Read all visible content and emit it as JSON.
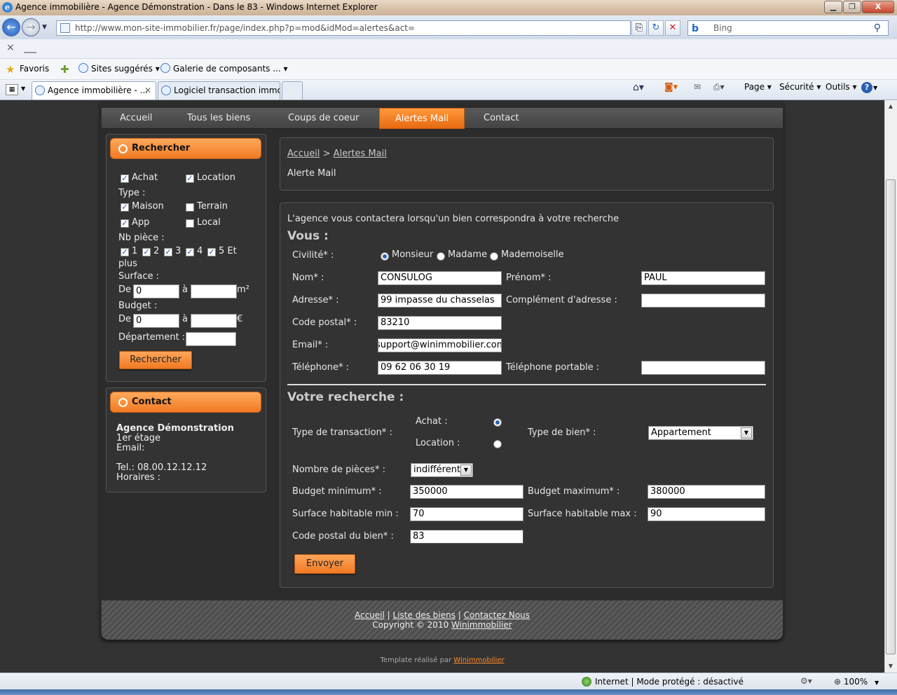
{
  "window": {
    "title": "Agence immobilière - Agence Démonstration - Dans le 83 - Windows Internet Explorer",
    "minimize": "▁",
    "maximize": "❐",
    "close": "X"
  },
  "browser": {
    "url": "http://www.mon-site-immobilier.fr/page/index.php?p=mod&idMod=alertes&act=",
    "search_placeholder": "Bing",
    "favorites_label": "Favoris",
    "favorites_items": [
      "Sites suggérés ▾",
      "Galerie de composants ... ▾"
    ],
    "tabs": [
      "Agence immobilière - ...",
      "Logiciel transaction immo..."
    ],
    "commands": [
      "Page ▾",
      "Sécurité ▾",
      "Outils ▾"
    ],
    "status_text": "Internet | Mode protégé : désactivé",
    "zoom": "100%"
  },
  "menu": [
    "Accueil",
    "Tous les biens",
    "Coups de coeur",
    "Alertes Mail",
    "Contact"
  ],
  "search_panel": {
    "title": "Rechercher",
    "achat": "Achat",
    "location": "Location",
    "type_label": "Type :",
    "maison": "Maison",
    "terrain": "Terrain",
    "app": "App",
    "local": "Local",
    "nb_piece_label": "Nb pièce :",
    "pieces": [
      "1",
      "2",
      "3",
      "4",
      "5 Et"
    ],
    "plus": "plus",
    "surface_label": "Surface :",
    "de": "De",
    "a": "à",
    "surface_from": "0",
    "m2": "m²",
    "budget_label": "Budget :",
    "budget_from": "0",
    "euro": "€",
    "departement_label": "Département :",
    "button": "Rechercher"
  },
  "contact_panel": {
    "title": "Contact",
    "agency": "Agence Démonstration",
    "address": "1er étage",
    "email": "Email:",
    "tel": "Tel.: 08.00.12.12.12",
    "horaires": "Horaires :"
  },
  "breadcrumb": {
    "home": "Accueil",
    "sep": ">",
    "current": "Alertes Mail",
    "page_title": "Alerte Mail"
  },
  "form": {
    "intro": "L'agence vous contactera lorsqu'un bien correspondra à votre recherche",
    "vous_title": "Vous :",
    "civilite_label": "Civilité* :",
    "civilites": [
      "Monsieur",
      "Madame",
      "Mademoiselle"
    ],
    "nom_label": "Nom* :",
    "nom": "CONSULOG",
    "prenom_label": "Prénom* :",
    "prenom": "PAUL",
    "adresse_label": "Adresse* :",
    "adresse": "99 impasse du chasselas",
    "complement_label": "Complément d'adresse :",
    "complement": "",
    "cp_label": "Code postal* :",
    "cp": "83210",
    "email_label": "Email* :",
    "email": "support@winimmobilier.com",
    "tel_label": "Téléphone* :",
    "tel": "09 62 06 30 19",
    "portable_label": "Téléphone portable :",
    "portable": "",
    "recherche_title": "Votre recherche :",
    "transaction_label": "Type de transaction* :",
    "achat": "Achat :",
    "location": "Location :",
    "typebien_label": "Type de bien* :",
    "typebien": "Appartement",
    "pieces_label": "Nombre de pièces* :",
    "pieces": "indifférent",
    "budget_min_label": "Budget minimum* :",
    "budget_min": "350000",
    "budget_max_label": "Budget maximum* :",
    "budget_max": "380000",
    "surf_min_label": "Surface habitable min :",
    "surf_min": "70",
    "surf_max_label": "Surface habitable max :",
    "surf_max": "90",
    "cp_bien_label": "Code postal du bien* :",
    "cp_bien": "83",
    "submit": "Envoyer"
  },
  "footer": {
    "links": [
      "Accueil",
      "Liste des biens",
      "Contactez Nous"
    ],
    "sep": "|",
    "copyright": "Copyright © 2010",
    "brand": "Winimmobilier",
    "template": "Template réalisé par",
    "template_brand": "Winimmobilier"
  }
}
